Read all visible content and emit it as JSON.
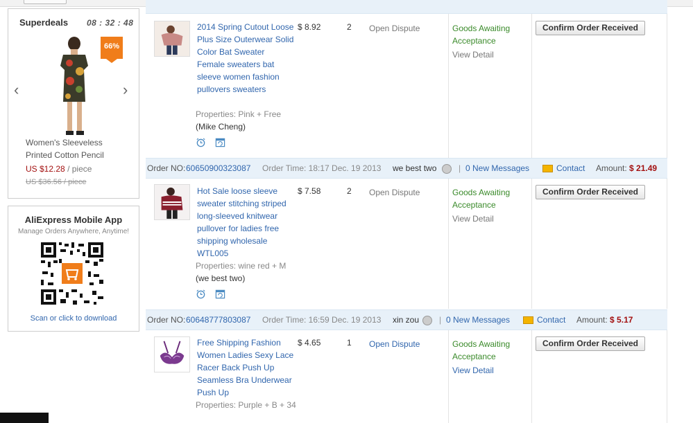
{
  "superdeals": {
    "title": "Superdeals",
    "timer": "08 : 32 : 48",
    "badge": "66%",
    "product_line1": "Women's Sleeveless",
    "product_line2": "Printed Cotton Pencil",
    "price": "US $12.28",
    "price_unit": "/ piece",
    "old_price": "US $36.56 / piece",
    "prev_icon": "chevron-left-icon",
    "next_icon": "chevron-right-icon"
  },
  "mobile_app": {
    "title": "AliExpress Mobile App",
    "subtitle": "Manage Orders Anywhere, Anytime!",
    "link": "Scan or click to download"
  },
  "orders": [
    {
      "item_name": "2014 Spring Cutout Loose Plus Size Outerwear Solid Color Bat Sweater Female sweaters bat sleeve women fashion pullovers sweaters",
      "properties": "Properties: Pink   + Free",
      "buyer": "(Mike Cheng)",
      "price": "$ 8.92",
      "qty": "2",
      "dispute": "Open Dispute",
      "status": "Goods Awaiting Acceptance",
      "detail": "View Detail",
      "action": "Confirm Order Received"
    },
    {
      "order_no_label": "Order NO:",
      "order_no": "60650900323087",
      "order_time": "Order Time: 18:17 Dec. 19 2013",
      "seller": "we best two",
      "messages": "0 New Messages",
      "contact": "Contact",
      "amount_label": "Amount:",
      "amount": "$ 21.49",
      "item_name": "Hot Sale loose sleeve sweater stitching striped long-sleeved knitwear pullover for ladies free shipping wholesale WTL005",
      "properties": "Properties: wine red   + M",
      "buyer": "(we best two)",
      "price": "$ 7.58",
      "qty": "2",
      "dispute": "Open Dispute",
      "status": "Goods Awaiting Acceptance",
      "detail": "View Detail",
      "action": "Confirm Order Received"
    },
    {
      "order_no_label": "Order NO:",
      "order_no": "60648777803087",
      "order_time": "Order Time: 16:59 Dec. 19 2013",
      "seller": "xin zou",
      "messages": "0 New Messages",
      "contact": "Contact",
      "amount_label": "Amount:",
      "amount": "$ 5.17",
      "item_name": "Free Shipping Fashion Women Ladies Sexy Lace Racer Back Push Up Seamless Bra Underwear Push Up",
      "properties": "Properties: Purple   + B   + 34",
      "price": "$ 4.65",
      "qty": "1",
      "dispute": "Open Dispute",
      "status": "Goods Awaiting Acceptance",
      "detail": "View Detail",
      "action": "Confirm Order Received"
    }
  ],
  "separator": "|",
  "colors": {
    "link": "#3166ad",
    "amount": "#a31010",
    "status": "#3a8a2a",
    "header_bg": "#e8f1f9"
  }
}
